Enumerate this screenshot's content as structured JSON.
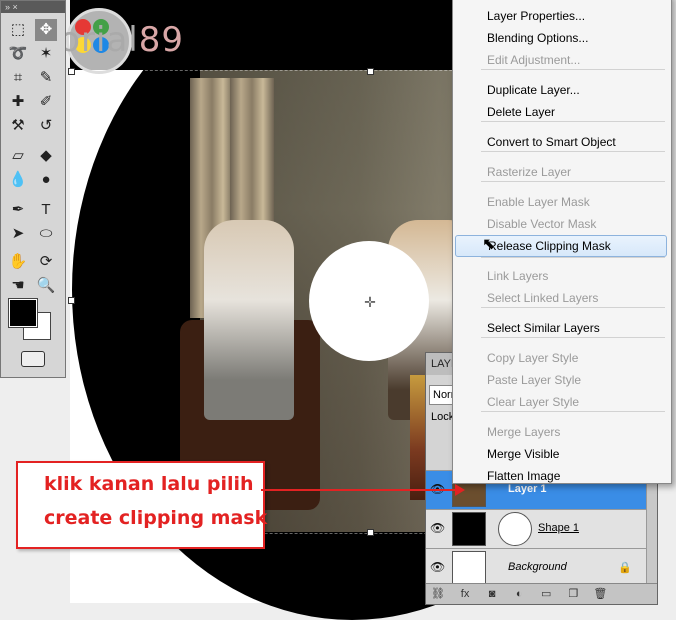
{
  "logo": {
    "text": "tutorial",
    "number": "89",
    "dot_colors": [
      "#e53935",
      "#43a047",
      "#fdd835",
      "#1e88e5"
    ]
  },
  "toolbox": {
    "tools": [
      "marquee-icon",
      "move-icon",
      "lasso-icon",
      "magic-wand-icon",
      "crop-icon",
      "eyedropper-icon",
      "healing-brush-icon",
      "brush-icon",
      "clone-stamp-icon",
      "history-brush-icon",
      "eraser-icon",
      "paint-bucket-icon",
      "blur-icon",
      "dodge-icon",
      "pen-icon",
      "type-icon",
      "path-select-icon",
      "ellipse-icon",
      "hand-icon",
      "rotate-view-icon",
      "hand-tool-icon",
      "zoom-icon"
    ],
    "foreground_color": "#000000",
    "background_color": "#ffffff"
  },
  "layers_panel": {
    "tab_label": "LAYE",
    "blend_mode": "Norm",
    "lock_label": "Lock",
    "layers": [
      {
        "name": "Layer 1",
        "selected": true
      },
      {
        "name": "Shape 1",
        "selected": false
      },
      {
        "name": "Background",
        "selected": false
      }
    ],
    "footer_icons": [
      "link-icon",
      "fx-icon",
      "mask-icon",
      "adjustment-icon",
      "group-icon",
      "new-layer-icon",
      "trash-icon"
    ],
    "footer_fx": "fx"
  },
  "context_menu": {
    "items": [
      {
        "label": "Layer Properties...",
        "disabled": false
      },
      {
        "label": "Blending Options...",
        "disabled": false
      },
      {
        "label": "Edit Adjustment...",
        "disabled": true
      },
      {
        "label": "Duplicate Layer...",
        "disabled": false
      },
      {
        "label": "Delete Layer",
        "disabled": false
      },
      {
        "label": "Convert to Smart Object",
        "disabled": false
      },
      {
        "label": "Rasterize Layer",
        "disabled": true
      },
      {
        "label": "Enable Layer Mask",
        "disabled": true
      },
      {
        "label": "Disable Vector Mask",
        "disabled": true
      },
      {
        "label": "Release Clipping Mask",
        "disabled": false,
        "highlighted": true
      },
      {
        "label": "Link Layers",
        "disabled": true
      },
      {
        "label": "Select Linked Layers",
        "disabled": true
      },
      {
        "label": "Select Similar Layers",
        "disabled": false
      },
      {
        "label": "Copy Layer Style",
        "disabled": true
      },
      {
        "label": "Paste Layer Style",
        "disabled": true
      },
      {
        "label": "Clear Layer Style",
        "disabled": true
      },
      {
        "label": "Merge Layers",
        "disabled": true
      },
      {
        "label": "Merge Visible",
        "disabled": false
      },
      {
        "label": "Flatten Image",
        "disabled": false
      }
    ]
  },
  "annotation": {
    "line1": "klik kanan lalu pilih",
    "line2": "create clipping mask",
    "color": "#e32222"
  }
}
